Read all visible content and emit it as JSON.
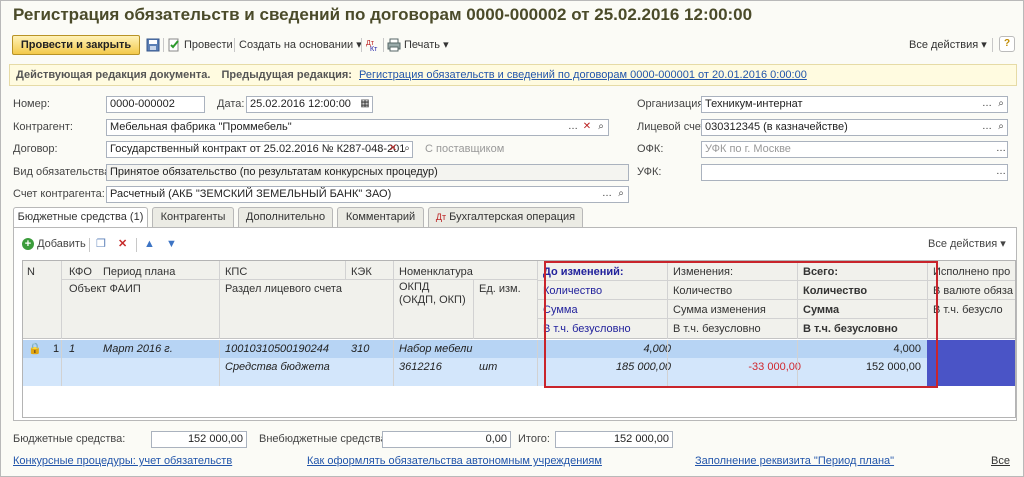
{
  "window": {
    "title": "Регистрация обязательств и сведений по договорам 0000-000002 от 25.02.2016 12:00:00"
  },
  "toolbar": {
    "post_close": "Провести и закрыть",
    "post": "Провести",
    "create_based": "Создать на основании",
    "print": "Печать",
    "all_actions": "Все действия",
    "help": "?"
  },
  "info_bar": {
    "current_label": "Действующая редакция документа.",
    "prev_label": "Предыдущая редакция:",
    "prev_link": "Регистрация обязательств и сведений по договорам 0000-000001 от 20.01.2016 0:00:00"
  },
  "form": {
    "number_label": "Номер:",
    "number": "0000-000002",
    "date_label": "Дата:",
    "date": "25.02.2016 12:00:00",
    "org_label": "Организация:",
    "org": "Техникум-интернат",
    "contractor_label": "Контрагент:",
    "contractor": "Мебельная фабрика \"Проммебель\"",
    "personal_account_label": "Лицевой счет:",
    "personal_account": "030312345 (в казначействе)",
    "contract_label": "Договор:",
    "contract": "Государственный контракт от 25.02.2016 № К287-048-201",
    "with_supplier": "С поставщиком",
    "ofk_label": "ОФК:",
    "ofk": "УФК по г. Москве",
    "obligation_label": "Вид обязательства:",
    "obligation": "Принятое обязательство (по результатам конкурсных процедур)",
    "ufk_label": "УФК:",
    "ufk": "",
    "contractor_account_label": "Счет контрагента:",
    "contractor_account": "Расчетный (АКБ \"ЗЕМСКИЙ ЗЕМЕЛЬНЫЙ БАНК\" ЗАО)"
  },
  "tabs": [
    {
      "label": "Бюджетные средства (1)"
    },
    {
      "label": "Контрагенты"
    },
    {
      "label": "Дополнительно"
    },
    {
      "label": "Комментарий"
    },
    {
      "label": "Бухгалтерская операция"
    }
  ],
  "grid_toolbar": {
    "add": "Добавить",
    "all_actions": "Все действия"
  },
  "grid": {
    "headers": {
      "n": "N",
      "kfo": "КФО",
      "plan_period": "Период плана",
      "faip": "Объект ФАИП",
      "kps": "КПС",
      "account_section": "Раздел лицевого счета",
      "kek": "КЭК",
      "nomenclature": "Номенклатура",
      "okpd": "ОКПД (ОКДП, ОКП)",
      "unit": "Ед. изм.",
      "before": "До изменений:",
      "before_qty": "Количество",
      "before_sum": "Сумма",
      "before_uncond": "В т.ч. безусловно",
      "change": "Изменения:",
      "change_qty": "Количество",
      "change_sum": "Сумма изменения",
      "change_uncond": "В т.ч. безусловно",
      "total": "Всего:",
      "total_qty": "Количество",
      "total_sum": "Сумма",
      "total_uncond": "В т.ч. безусловно",
      "executed": "Исполнено про",
      "executed_currency": "В валюте обяза",
      "executed_uncond": "В т.ч. безусло"
    },
    "row": {
      "n": "1",
      "kfo": "1",
      "plan_period": "Март 2016 г.",
      "kps": "10010310500190244",
      "kek": "310",
      "nomenclature": "Набор мебели",
      "account_section": "Средства бюджета",
      "okpd": "3612216",
      "unit": "шт",
      "before_qty": "4,000",
      "before_sum": "185 000,00",
      "change_sum": "-33 000,00",
      "total_qty": "4,000",
      "total_sum": "152 000,00"
    },
    "highlight_color": "#c9242b"
  },
  "totals": {
    "budget_label": "Бюджетные средства:",
    "budget": "152 000,00",
    "nonbudget_label": "Внебюджетные средства:",
    "nonbudget": "0,00",
    "total_label": "Итого:",
    "total": "152 000,00"
  },
  "links": {
    "procedures": "Конкурсные процедуры: учет обязательств",
    "how_to": "Как оформлять обязательства автономным учреждениям",
    "fill_period": "Заполнение реквизита \"Период плана\"",
    "all": "Все"
  }
}
